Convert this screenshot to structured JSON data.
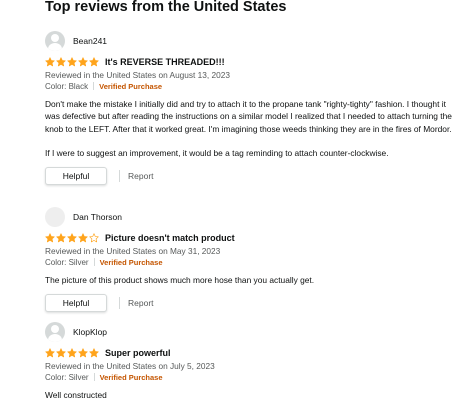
{
  "section_title": "Top reviews from the United States",
  "colors": {
    "star": "#ffa41c",
    "star_empty": "#ffffff",
    "verified": "#c45500"
  },
  "reviews": [
    {
      "name": "Bean241",
      "rating": 5,
      "title": "It's REVERSE THREADED!!!",
      "meta": "Reviewed in the United States on August 13, 2023",
      "variant": "Color: Black",
      "verified": "Verified Purchase",
      "body": [
        "Don't make the mistake I initially did and try to attach it to the propane tank \"righty-tighty\" fashion. I thought it was defective but after reading the instructions on a similar model I realized that I needed to attach turning the knob to the LEFT. After that it worked great. I'm imagining those weeds thinking they are in the fires of Mordor.",
        "If I were to suggest an improvement, it would be a tag reminding to attach counter-clockwise."
      ],
      "helpful": "Helpful",
      "report": "Report"
    },
    {
      "name": "Dan Thorson",
      "rating": 4,
      "title": "Picture doesn't match product",
      "meta": "Reviewed in the United States on May 31, 2023",
      "variant": "Color: Silver",
      "verified": "Verified Purchase",
      "body": [
        "The picture of this product shows much more hose than you actually get."
      ],
      "helpful": "Helpful",
      "report": "Report"
    },
    {
      "name": "KlopKlop",
      "rating": 5,
      "title": "Super powerful",
      "meta": "Reviewed in the United States on July 5, 2023",
      "variant": "Color: Silver",
      "verified": "Verified Purchase",
      "body": [
        "Well constructed"
      ]
    }
  ]
}
